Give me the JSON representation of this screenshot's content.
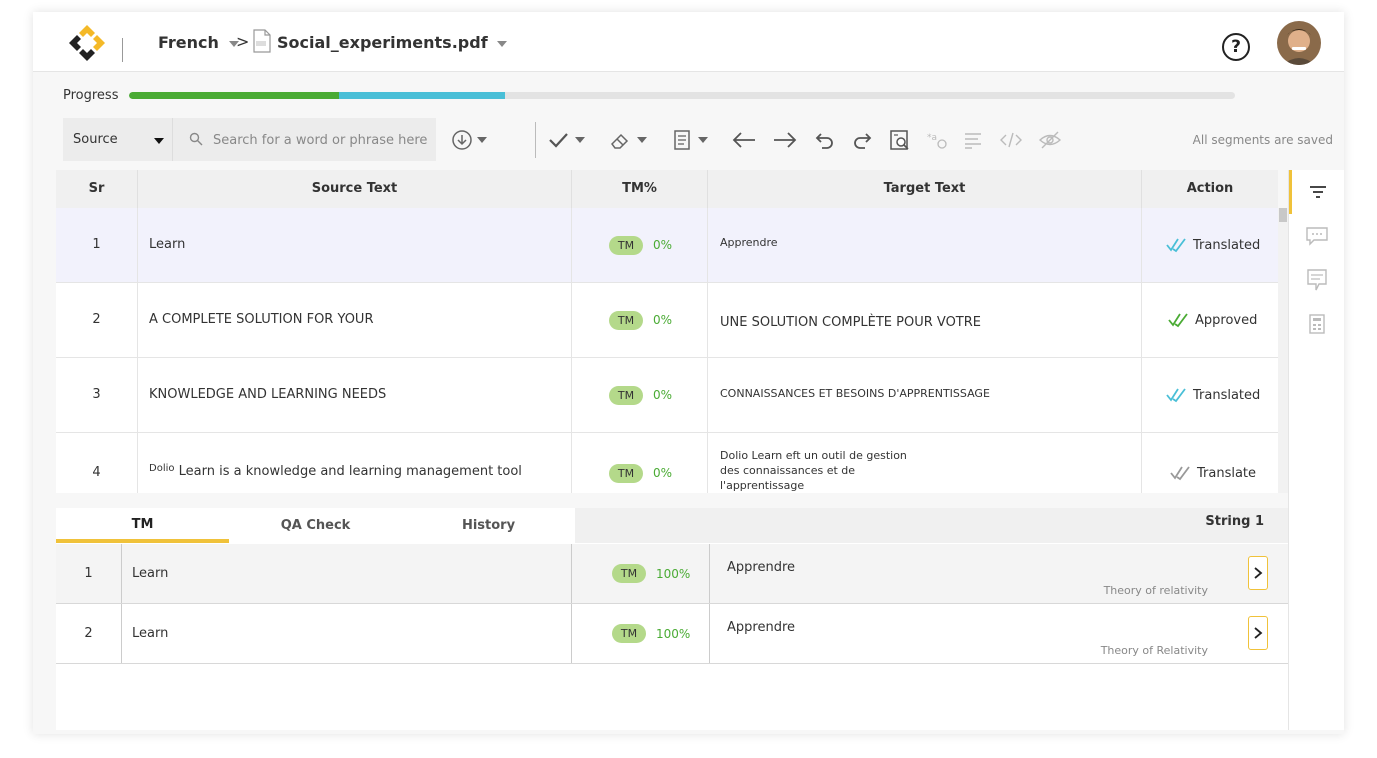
{
  "header": {
    "language": "French",
    "file_name": "Social_experiments.pdf",
    "help_label": "?"
  },
  "progress": {
    "label": "Progress",
    "approved_fraction": 0.19,
    "translated_fraction": 0.15
  },
  "toolbar": {
    "source_select": "Source",
    "search_placeholder": "Search for a word or phrase here",
    "save_status": "All segments are saved"
  },
  "table": {
    "columns": [
      "Sr",
      "Source Text",
      "TM%",
      "Target Text",
      "Action"
    ],
    "rows": [
      {
        "sr": "1",
        "source": "Learn",
        "source_prefix": "",
        "tm_badge": "TM",
        "tm_pct": "0%",
        "target": "Apprendre",
        "action": "Translated"
      },
      {
        "sr": "2",
        "source": "A COMPLETE SOLUTION FOR YOUR",
        "source_prefix": "",
        "tm_badge": "TM",
        "tm_pct": "0%",
        "target": "UNE SOLUTION COMPLÈTE POUR VOTRE",
        "action": "Approved"
      },
      {
        "sr": "3",
        "source": "KNOWLEDGE AND LEARNING NEEDS",
        "source_prefix": "",
        "tm_badge": "TM",
        "tm_pct": "0%",
        "target": "CONNAISSANCES ET BESOINS D'APPRENTISSAGE",
        "action": "Translated"
      },
      {
        "sr": "4",
        "source": "Learn is a knowledge and learning management tool",
        "source_prefix": "Dolio",
        "tm_badge": "TM",
        "tm_pct": "0%",
        "target": "Dolio Learn eft un outil de gestion des connaissances et de l'apprentissage",
        "action": "Translate"
      }
    ]
  },
  "bottom": {
    "tabs": [
      "TM",
      "QA Check",
      "History"
    ],
    "string_label": "String 1",
    "rows": [
      {
        "sr": "1",
        "source": "Learn",
        "tm_badge": "TM",
        "tm_pct": "100%",
        "target": "Apprendre",
        "tm_source": "Theory of relativity"
      },
      {
        "sr": "2",
        "source": "Learn",
        "tm_badge": "TM",
        "tm_pct": "100%",
        "target": "Apprendre",
        "tm_source": "Theory of Relativity"
      }
    ]
  },
  "colors": {
    "accent": "#f0c23a",
    "approved": "#4aab34",
    "translated": "#49bfd7",
    "tm_badge": "#b4d98a"
  },
  "icons": [
    "app-logo",
    "pdf-file-icon",
    "help-icon",
    "user-avatar",
    "search-icon",
    "download-icon",
    "check-icon",
    "eraser-icon",
    "document-icon",
    "arrow-left-icon",
    "arrow-right-icon",
    "undo-icon",
    "redo-icon",
    "find-replace-icon",
    "special-chars-icon",
    "format-icon",
    "code-tag-icon",
    "hide-icon",
    "filter-icon",
    "comment-icon",
    "notes-icon",
    "calculator-icon",
    "chevron-right-icon"
  ]
}
